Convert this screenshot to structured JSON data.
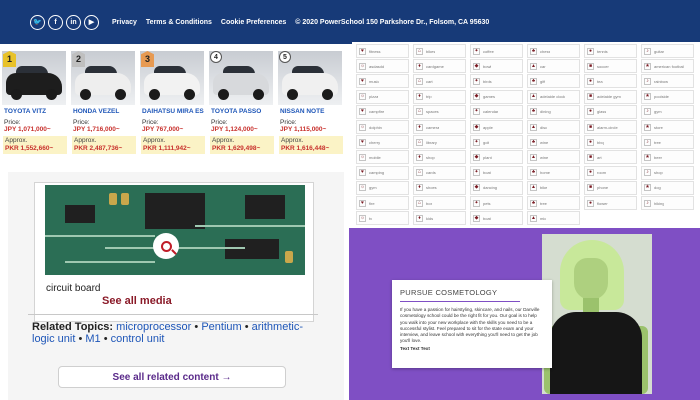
{
  "footer": {
    "social_icons": [
      {
        "name": "twitter-icon",
        "glyph": "🐦"
      },
      {
        "name": "facebook-icon",
        "glyph": "f"
      },
      {
        "name": "linkedin-icon",
        "glyph": "in"
      },
      {
        "name": "youtube-icon",
        "glyph": "▶"
      }
    ],
    "links": [
      "Privacy",
      "Terms & Conditions",
      "Cookie Preferences"
    ],
    "address": "© 2020 PowerSchool 150 Parkshore Dr., Folsom, CA 95630",
    "background": "#173a78"
  },
  "cars": {
    "price_label": "Price:",
    "approx_label": "Approx.",
    "items": [
      {
        "rank": "1",
        "name": "TOYOTA VITZ",
        "price": "JPY 1,071,000~",
        "approx": "PKR 1,552,660~",
        "body_color": "#1d1d1d"
      },
      {
        "rank": "2",
        "name": "HONDA VEZEL",
        "price": "JPY 1,716,000~",
        "approx": "PKR 2,487,736~",
        "body_color": "#eeeeee"
      },
      {
        "rank": "3",
        "name": "DAIHATSU MIRA ES",
        "price": "JPY 767,000~",
        "approx": "PKR 1,111,942~",
        "body_color": "#f2f2f2"
      },
      {
        "rank": "4",
        "name": "TOYOTA PASSO",
        "price": "JPY 1,124,000~",
        "approx": "PKR 1,629,498~",
        "body_color": "#d7d9dc"
      },
      {
        "rank": "5",
        "name": "NISSAN NOTE",
        "price": "JPY 1,115,000~",
        "approx": "PKR 1,616,448~",
        "body_color": "#f0f0f0"
      }
    ]
  },
  "media": {
    "caption": "circuit board",
    "see_all": "See all media",
    "related_heading": "Related Topics:",
    "related_links": [
      "microprocessor",
      "Pentium",
      "arithmetic-logic unit",
      "M1",
      "control unit"
    ],
    "related_button": "See all related content →"
  },
  "icon_grid": {
    "accent": "#7a1a22",
    "items": [
      "fitness",
      "bikes",
      "coffee",
      "chess",
      "tennis",
      "guitar",
      "asdasdd",
      "cardgame",
      "bowl",
      "car",
      "soccer",
      "american football",
      "music",
      "cart",
      "birds",
      "gift",
      "tea",
      "rainbow",
      "pizza",
      "trip",
      "games",
      "adelaide clock",
      "adelaide gym",
      "poolside",
      "campfire",
      "spaces",
      "calendar",
      "dining",
      "glass",
      "gym",
      "dolphin",
      "camera",
      "apple",
      "disc",
      "alarm-circle",
      "store",
      "cherry",
      "library",
      "golf",
      "wine",
      "bbq",
      "tree",
      "mobile",
      "shop",
      "plant",
      "wine",
      "art",
      "beer",
      "camping",
      "cards",
      "boat",
      "home",
      "room",
      "shop",
      "gym",
      "shoes",
      "dancing",
      "bike",
      "phone",
      "dog",
      "fire",
      "box",
      "pets",
      "tree",
      "flower",
      "hiking",
      "tv",
      "kids",
      "boat",
      "mic"
    ]
  },
  "promo": {
    "title": "PURSUE COSMETOLOGY",
    "body": "If you have a passion for hairstyling, skincare, and nails, our Danville cosmetology school could be the right fit for you. Our goal is to help you walk into your new workplace with the skills you need to be a successful stylist. Feel prepared to sit for the state exam and your interview, and leave school with everything you'll need to get the job you'll love.",
    "cta": "Text Text Text",
    "background": "#7f4fc4"
  }
}
